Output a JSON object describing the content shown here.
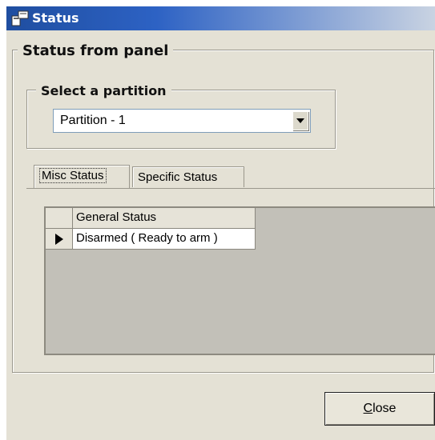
{
  "window": {
    "title": "Status",
    "icon": "status-app-icon"
  },
  "panel": {
    "group_label": "Status from panel"
  },
  "partition": {
    "group_label": "Select a partition",
    "selected": "Partition - 1"
  },
  "tabs": [
    {
      "label": "Misc Status",
      "active": true
    },
    {
      "label": "Specific Status",
      "active": false
    }
  ],
  "grid": {
    "columns": [
      "General Status"
    ],
    "rows": [
      {
        "current": true,
        "values": [
          "Disarmed ( Ready to arm )"
        ]
      }
    ]
  },
  "buttons": {
    "close_mnemonic": "C",
    "close_rest": "lose"
  },
  "colors": {
    "title_start": "#1f4ea0",
    "face": "#e4e1d5",
    "grid_bg": "#c2c0b8"
  }
}
